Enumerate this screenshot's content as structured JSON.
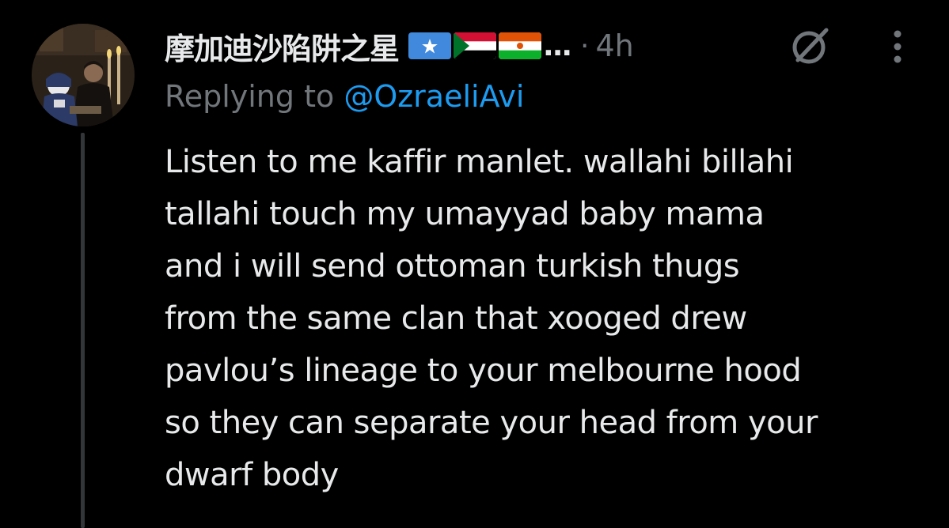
{
  "tweet": {
    "display_name": "摩加迪沙陷阱之星",
    "flags": [
      {
        "name": "somalia-flag",
        "colors": [
          "#4189dd",
          "#ffffff"
        ]
      },
      {
        "name": "sudan-flag",
        "colors": [
          "#d21034",
          "#ffffff",
          "#000000",
          "#007229"
        ]
      },
      {
        "name": "niger-flag",
        "colors": [
          "#e05206",
          "#ffffff",
          "#0db02b"
        ]
      }
    ],
    "ellipsis": "...",
    "separator": "·",
    "timestamp": "4h",
    "replying_prefix": "Replying to ",
    "replying_handle": "@OzraeliAvi",
    "text_lines": [
      "Listen to me kaffir manlet. wallahi billahi",
      "tallahi touch my umayyad baby mama",
      "and i will send ottoman turkish thugs",
      "from the same clan that xooged drew",
      "pavlou’s lineage to your melbourne hood",
      "so they can separate your head from your",
      "dwarf body"
    ]
  },
  "icons": {
    "grok": "grok-icon",
    "more": "more-options-icon"
  },
  "colors": {
    "background": "#000000",
    "primary_text": "#e7e9ea",
    "secondary_text": "#71767b",
    "accent": "#1d9bf0",
    "thread_line": "#333639"
  }
}
